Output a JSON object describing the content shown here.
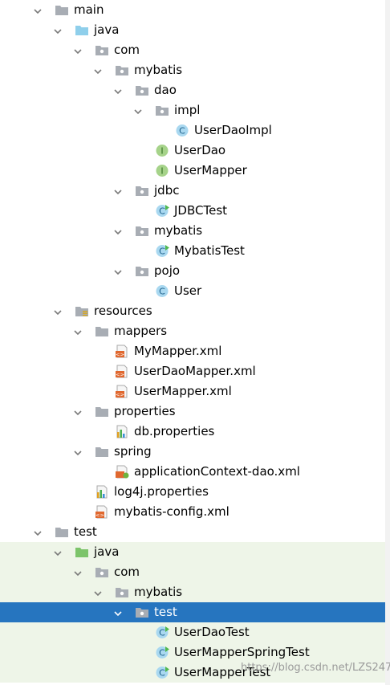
{
  "tree": [
    {
      "label": "main",
      "depth": 0,
      "expanded": true,
      "icon": "folder-icon",
      "kind": "folder"
    },
    {
      "label": "java",
      "depth": 1,
      "expanded": true,
      "icon": "source-folder-icon",
      "kind": "src"
    },
    {
      "label": "com",
      "depth": 2,
      "expanded": true,
      "icon": "package-icon",
      "kind": "pkg"
    },
    {
      "label": "mybatis",
      "depth": 3,
      "expanded": true,
      "icon": "package-icon",
      "kind": "pkg"
    },
    {
      "label": "dao",
      "depth": 4,
      "expanded": true,
      "icon": "package-icon",
      "kind": "pkg"
    },
    {
      "label": "impl",
      "depth": 5,
      "expanded": true,
      "icon": "package-icon",
      "kind": "pkg"
    },
    {
      "label": "UserDaoImpl",
      "depth": 6,
      "expanded": null,
      "icon": "class-icon",
      "kind": "class"
    },
    {
      "label": "UserDao",
      "depth": 5,
      "expanded": null,
      "icon": "interface-icon",
      "kind": "iface"
    },
    {
      "label": "UserMapper",
      "depth": 5,
      "expanded": null,
      "icon": "interface-icon",
      "kind": "iface"
    },
    {
      "label": "jdbc",
      "depth": 4,
      "expanded": true,
      "icon": "package-icon",
      "kind": "pkg"
    },
    {
      "label": "JDBCTest",
      "depth": 5,
      "expanded": null,
      "icon": "runnable-class-icon",
      "kind": "runclass"
    },
    {
      "label": "mybatis",
      "depth": 4,
      "expanded": true,
      "icon": "package-icon",
      "kind": "pkg"
    },
    {
      "label": "MybatisTest",
      "depth": 5,
      "expanded": null,
      "icon": "runnable-class-icon",
      "kind": "runclass"
    },
    {
      "label": "pojo",
      "depth": 4,
      "expanded": true,
      "icon": "package-icon",
      "kind": "pkg"
    },
    {
      "label": "User",
      "depth": 5,
      "expanded": null,
      "icon": "class-icon",
      "kind": "class"
    },
    {
      "label": "resources",
      "depth": 1,
      "expanded": true,
      "icon": "resources-folder-icon",
      "kind": "res"
    },
    {
      "label": "mappers",
      "depth": 2,
      "expanded": true,
      "icon": "folder-icon",
      "kind": "folder"
    },
    {
      "label": "MyMapper.xml",
      "depth": 3,
      "expanded": null,
      "icon": "xml-file-icon",
      "kind": "xml"
    },
    {
      "label": "UserDaoMapper.xml",
      "depth": 3,
      "expanded": null,
      "icon": "xml-file-icon",
      "kind": "xml"
    },
    {
      "label": "UserMapper.xml",
      "depth": 3,
      "expanded": null,
      "icon": "xml-file-icon",
      "kind": "xml"
    },
    {
      "label": "properties",
      "depth": 2,
      "expanded": true,
      "icon": "folder-icon",
      "kind": "folder"
    },
    {
      "label": "db.properties",
      "depth": 3,
      "expanded": null,
      "icon": "properties-file-icon",
      "kind": "props"
    },
    {
      "label": "spring",
      "depth": 2,
      "expanded": true,
      "icon": "folder-icon",
      "kind": "folder"
    },
    {
      "label": "applicationContext-dao.xml",
      "depth": 3,
      "expanded": null,
      "icon": "spring-xml-icon",
      "kind": "springxml"
    },
    {
      "label": "log4j.properties",
      "depth": 2,
      "expanded": null,
      "icon": "properties-file-icon",
      "kind": "props"
    },
    {
      "label": "mybatis-config.xml",
      "depth": 2,
      "expanded": null,
      "icon": "xml-file-icon",
      "kind": "xml"
    },
    {
      "label": "test",
      "depth": 0,
      "expanded": true,
      "icon": "folder-icon",
      "kind": "folder"
    },
    {
      "label": "java",
      "depth": 1,
      "expanded": true,
      "icon": "test-source-folder-icon",
      "kind": "testsrc",
      "bg": "green"
    },
    {
      "label": "com",
      "depth": 2,
      "expanded": true,
      "icon": "package-icon",
      "kind": "pkg",
      "bg": "green"
    },
    {
      "label": "mybatis",
      "depth": 3,
      "expanded": true,
      "icon": "package-icon",
      "kind": "pkg",
      "bg": "green"
    },
    {
      "label": "test",
      "depth": 4,
      "expanded": true,
      "icon": "package-icon",
      "kind": "pkg",
      "bg": "selected"
    },
    {
      "label": "UserDaoTest",
      "depth": 5,
      "expanded": null,
      "icon": "runnable-class-icon",
      "kind": "runclass",
      "bg": "green"
    },
    {
      "label": "UserMapperSpringTest",
      "depth": 5,
      "expanded": null,
      "icon": "runnable-class-icon",
      "kind": "runclass",
      "bg": "green"
    },
    {
      "label": "UserMapperTest",
      "depth": 5,
      "expanded": null,
      "icon": "runnable-class-icon",
      "kind": "runclass",
      "bg": "green"
    }
  ],
  "watermark": "https://blog.csdn.net/LZS247",
  "colors": {
    "selected": "#2675bf",
    "test_bg": "#eef5e8",
    "folder": "#a8adb4",
    "source_folder": "#8fcfeb",
    "test_folder": "#7cc46a",
    "class": "#4ba3d3",
    "interface": "#6aaa4a",
    "xml": "#e0682f"
  }
}
